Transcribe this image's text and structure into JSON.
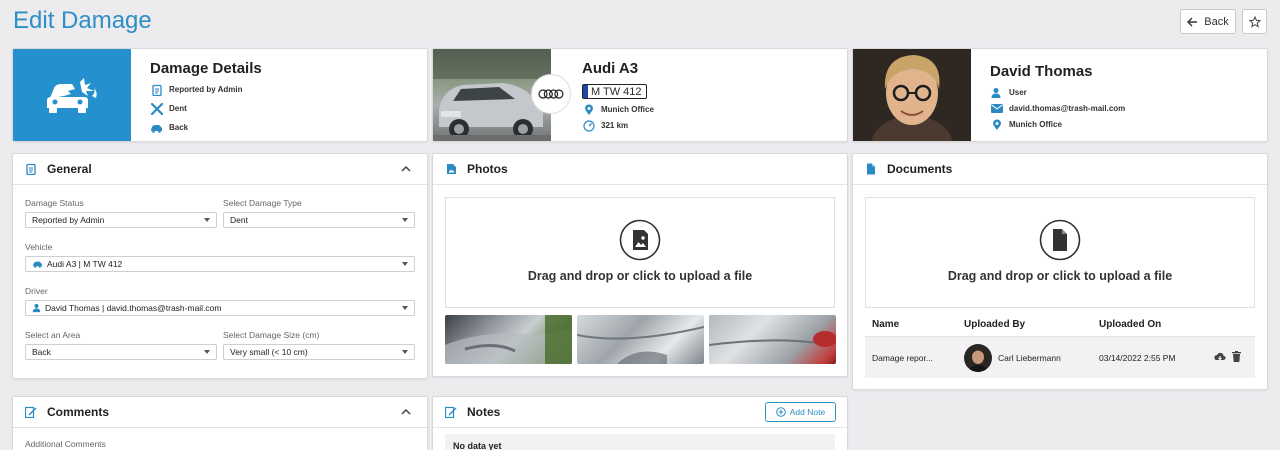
{
  "page": {
    "title": "Edit Damage"
  },
  "toolbar": {
    "back_label": "Back",
    "favorite_icon": "star-icon"
  },
  "damage_summary": {
    "title": "Damage Details",
    "status": "Reported by Admin",
    "type": "Dent",
    "area": "Back",
    "hero_icon": "car-damage-icon",
    "hero_color": "#2590ce"
  },
  "vehicle_summary": {
    "name": "Audi A3",
    "plate": "M TW 412",
    "location": "Munich Office",
    "mileage": "321 km",
    "brand_icon": "audi-rings-icon"
  },
  "driver_summary": {
    "name": "David Thomas",
    "role": "User",
    "email": "david.thomas@trash-mail.com",
    "location": "Munich Office"
  },
  "general": {
    "title": "General",
    "damage_status": {
      "label": "Damage Status",
      "value": "Reported by Admin"
    },
    "damage_type": {
      "label": "Select Damage Type",
      "value": "Dent"
    },
    "vehicle": {
      "label": "Vehicle",
      "value": "Audi A3 | M TW 412"
    },
    "driver": {
      "label": "Driver",
      "value": "David Thomas | david.thomas@trash-mail.com"
    },
    "area": {
      "label": "Select an Area",
      "value": "Back"
    },
    "damage_size": {
      "label": "Select Damage Size (cm)",
      "value": "Very small (< 10 cm)"
    }
  },
  "photos": {
    "title": "Photos",
    "drop_text": "Drag and drop or click to upload a file"
  },
  "documents": {
    "title": "Documents",
    "drop_text": "Drag and drop or click to upload a file",
    "columns": [
      "Name",
      "Uploaded By",
      "Uploaded On"
    ],
    "rows": [
      {
        "name": "Damage repor...",
        "uploaded_by": "Carl Liebermann",
        "uploaded_on": "03/14/2022 2:55 PM"
      }
    ]
  },
  "comments": {
    "title": "Comments",
    "field_label": "Additional Comments"
  },
  "notes": {
    "title": "Notes",
    "add_label": "Add Note",
    "empty_text": "No data yet"
  },
  "colors": {
    "accent": "#2e8fc6",
    "icon_blue": "#2a8ac4"
  }
}
